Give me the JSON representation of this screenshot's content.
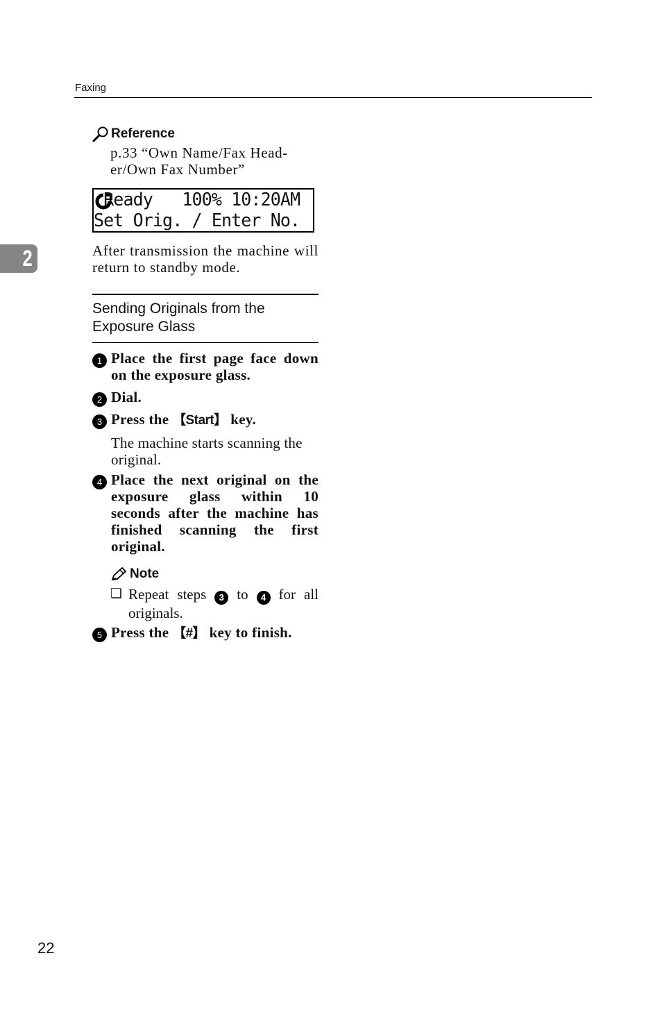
{
  "running_head": "Faxing",
  "reference": {
    "title": "Reference",
    "text": "p.33 “Own Name/Fax Head-er/Own Fax Number”"
  },
  "lcd_display": {
    "line1": " Ready   100% 10:20AM",
    "line2": "Set Orig. / Enter No."
  },
  "chapter_tab": "2",
  "after_transmission_text": "After transmission the machine will return to standby mode.",
  "section": {
    "title": "Sending Originals from the Exposure Glass"
  },
  "steps": [
    {
      "num": "1",
      "text": "Place the first page face down on the exposure glass."
    },
    {
      "num": "2",
      "text": "Dial."
    },
    {
      "num": "3",
      "text_before": "Press the ",
      "key": "【Start】",
      "text_after": " key.",
      "body": "The machine starts scanning the original."
    },
    {
      "num": "4",
      "text": "Place the next original on the exposure glass within 10 seconds after the machine has finished scanning the first original."
    },
    {
      "num": "5",
      "text_before": "Press the ",
      "key": "【#】",
      "text_after": " key to finish."
    }
  ],
  "note": {
    "title": "Note",
    "item_before": "Repeat steps ",
    "item_num_a": "3",
    "item_mid": " to ",
    "item_num_b": "4",
    "item_after": " for all originals."
  },
  "page_number": "22"
}
